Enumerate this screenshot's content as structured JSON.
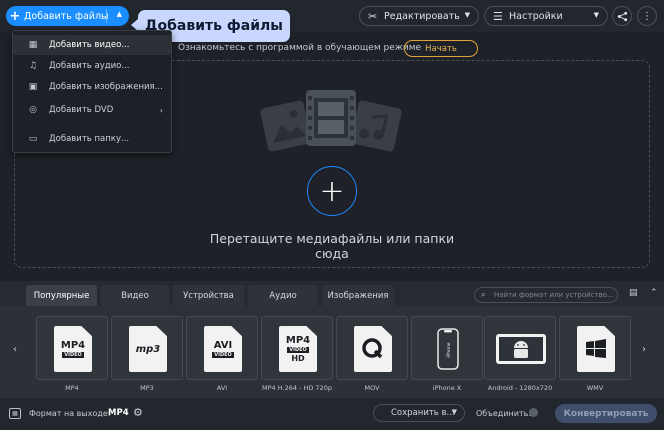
{
  "toolbar": {
    "add_files_label": "Добавить файлы",
    "edit_label": "Редактировать",
    "settings_label": "Настройки"
  },
  "tooltip": {
    "text": "Добавить файлы"
  },
  "tutorial": {
    "text": "Ознакомьтесь с программой в обучающем режиме",
    "start_label": "Начать"
  },
  "menu": {
    "items": [
      {
        "label": "Добавить видео...",
        "icon": "film-icon"
      },
      {
        "label": "Добавить аудио...",
        "icon": "music-note-icon"
      },
      {
        "label": "Добавить изображения...",
        "icon": "image-icon"
      },
      {
        "label": "Добавить DVD",
        "icon": "dvd-icon"
      },
      {
        "label": "Добавить папку...",
        "icon": "folder-icon"
      }
    ]
  },
  "dropzone": {
    "text": "Перетащите медиафайлы или папки сюда"
  },
  "tabs": [
    {
      "label": "Популярные"
    },
    {
      "label": "Видео"
    },
    {
      "label": "Устройства"
    },
    {
      "label": "Аудио"
    },
    {
      "label": "Изображения"
    }
  ],
  "search": {
    "placeholder": "Найти формат или устройство..."
  },
  "formats": [
    {
      "label": "MP4",
      "badge": "MP4",
      "sub": "VIDEO"
    },
    {
      "label": "MP3",
      "badge": "mp3",
      "sub": ""
    },
    {
      "label": "AVI",
      "badge": "AVI",
      "sub": "VIDEO"
    },
    {
      "label": "MP4 H.264 - HD 720p",
      "badge": "MP4",
      "sub": "VIDEO",
      "extra": "HD"
    },
    {
      "label": "MOV",
      "badge": "",
      "sub": ""
    },
    {
      "label": "iPhone X",
      "badge": "",
      "sub": ""
    },
    {
      "label": "Android - 1280x720",
      "badge": "",
      "sub": ""
    },
    {
      "label": "WMV",
      "badge": "",
      "sub": ""
    }
  ],
  "status": {
    "output_format_label": "Формат на выходе:",
    "output_format_value": "MP4",
    "save_to_label": "Сохранить в...",
    "merge_label": "Объединить:",
    "convert_label": "Конвертировать"
  },
  "colors": {
    "accent": "#1a8dff",
    "tooltip_bg": "#c9d7ff",
    "tutorial_accent": "#e0a23a"
  }
}
